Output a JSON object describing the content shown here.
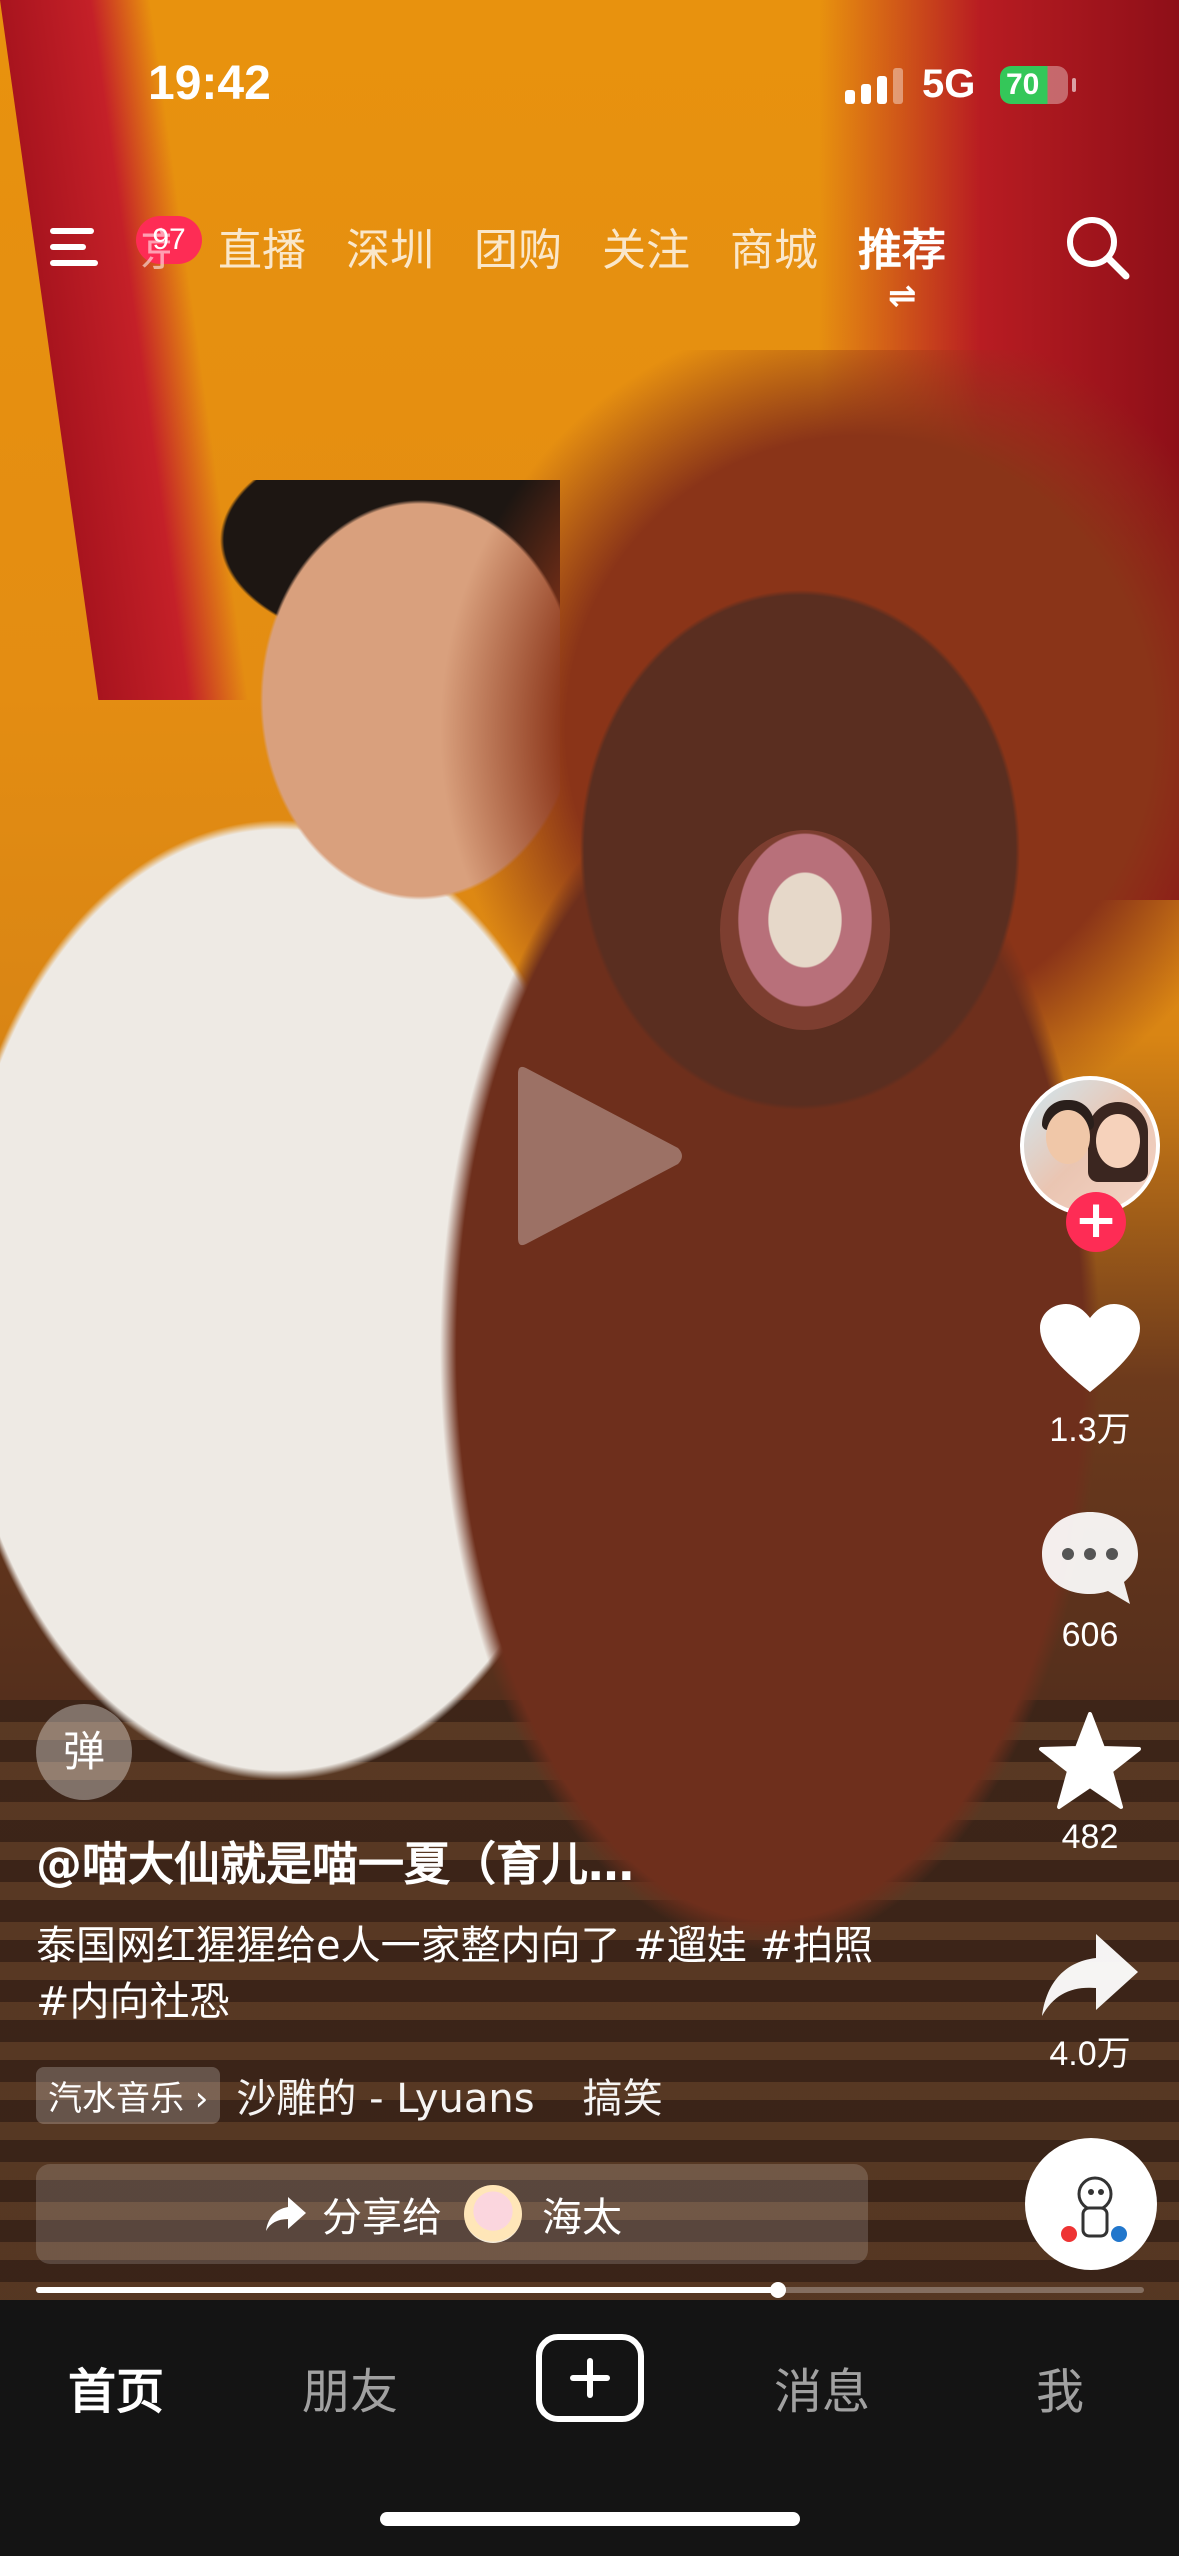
{
  "status_bar": {
    "time": "19:42",
    "network": "5G",
    "battery": "70",
    "signal_bars": 3
  },
  "top_nav": {
    "menu_badge": "97",
    "tabs": [
      {
        "label": "京",
        "state": "partial"
      },
      {
        "label": "直播",
        "state": "normal"
      },
      {
        "label": "深圳",
        "state": "normal"
      },
      {
        "label": "团购",
        "state": "normal"
      },
      {
        "label": "关注",
        "state": "normal"
      },
      {
        "label": "商城",
        "state": "normal"
      },
      {
        "label": "推荐",
        "state": "active"
      }
    ],
    "swap_glyph": "⇌"
  },
  "right_rail": {
    "follow_glyph": "+",
    "likes": "1.3万",
    "comments": "606",
    "favorites": "482",
    "shares": "4.0万"
  },
  "video": {
    "danmu_label": "弹",
    "author": "@喵大仙就是喵一夏（育儿…",
    "description": "泰国网红猩猩给e人一家整内向了 #遛娃 #拍照 #内向社恐",
    "music_tag": "汽水音乐 ›",
    "music_name": "沙雕的 - Lyuans",
    "music_extra": "搞笑",
    "share_label": "分享给",
    "share_target": "海太",
    "progress": 0.67
  },
  "bottom_tabs": {
    "home": "首页",
    "friends": "朋友",
    "messages": "消息",
    "me": "我"
  },
  "colors": {
    "accent": "#fe2c55",
    "battery_green": "#34c759",
    "tabbar_bg": "#141414"
  }
}
